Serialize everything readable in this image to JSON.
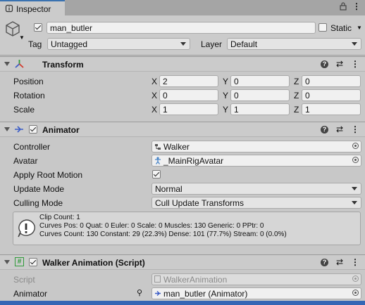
{
  "window": {
    "tab_label": "Inspector"
  },
  "gameobject": {
    "checked": true,
    "name": "man_butler",
    "static_label": "Static",
    "tag_label": "Tag",
    "tag_value": "Untagged",
    "layer_label": "Layer",
    "layer_value": "Default"
  },
  "transform": {
    "title": "Transform",
    "rows": [
      {
        "label": "Position",
        "x": "2",
        "y": "0",
        "z": "0"
      },
      {
        "label": "Rotation",
        "x": "0",
        "y": "0",
        "z": "0"
      },
      {
        "label": "Scale",
        "x": "1",
        "y": "1",
        "z": "1"
      }
    ],
    "axis": {
      "x": "X",
      "y": "Y",
      "z": "Z"
    }
  },
  "animator": {
    "title": "Animator",
    "controller_label": "Controller",
    "controller_value": "Walker",
    "avatar_label": "Avatar",
    "avatar_value": "_MainRigAvatar",
    "root_motion_label": "Apply Root Motion",
    "update_mode_label": "Update Mode",
    "update_mode_value": "Normal",
    "culling_mode_label": "Culling Mode",
    "culling_mode_value": "Cull Update Transforms",
    "info_line1": "Clip Count: 1",
    "info_line2": "Curves Pos: 0 Quat: 0 Euler: 0 Scale: 0 Muscles: 130 Generic: 0 PPtr: 0",
    "info_line3": "Curves Count: 130 Constant: 29 (22.3%) Dense: 101 (77.7%) Stream: 0 (0.0%)"
  },
  "script_comp": {
    "title": "Walker Animation (Script)",
    "script_label": "Script",
    "script_value": "WalkerAnimation",
    "animator_label": "Animator",
    "animator_value": "man_butler (Animator)"
  },
  "colors": {
    "accent": "#3566b5",
    "panel": "#c8c8c8",
    "header": "#cbcbcb"
  }
}
